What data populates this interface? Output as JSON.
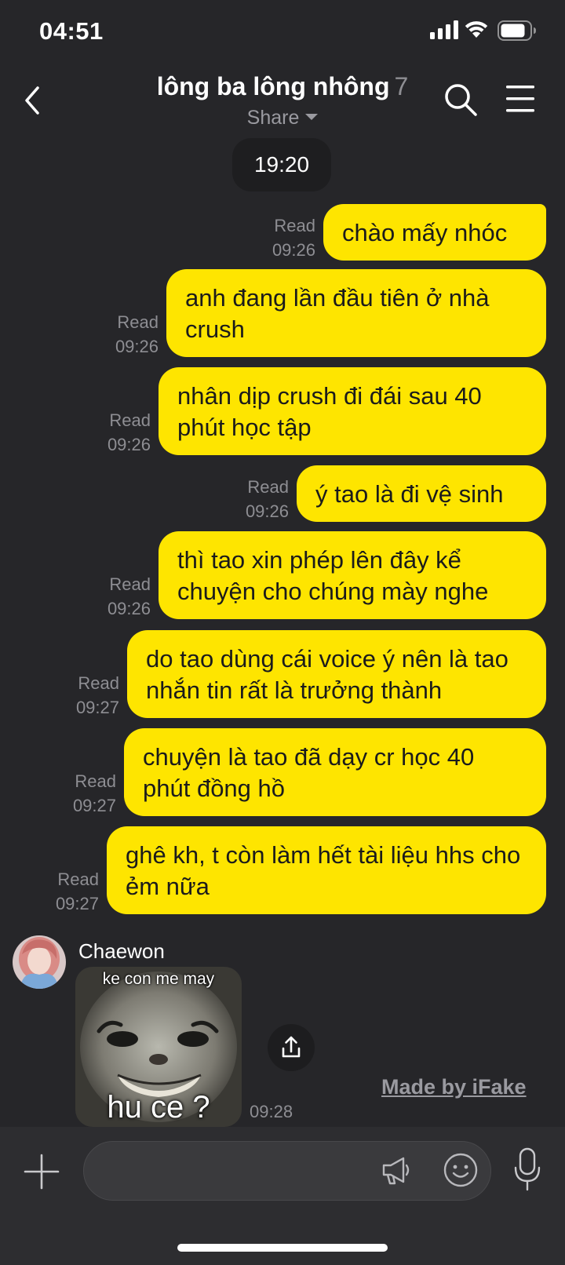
{
  "status_bar": {
    "time": "04:51"
  },
  "header": {
    "title": "lông ba lông nhông",
    "member_count": "7",
    "subtitle": "Share",
    "icons": {
      "back": "chevron-left-icon",
      "search": "search-icon",
      "menu": "menu-icon"
    }
  },
  "date_chip": "19:20",
  "messages": [
    {
      "text": "chào mấy nhóc",
      "status": "Read",
      "time": "09:26"
    },
    {
      "text": "anh đang lần đầu tiên ở nhà crush",
      "status": "Read",
      "time": "09:26"
    },
    {
      "text": "nhân dịp crush đi đái sau 40 phút học tập",
      "status": "Read",
      "time": "09:26"
    },
    {
      "text": "ý tao là đi vệ sinh",
      "status": "Read",
      "time": "09:26"
    },
    {
      "text": "thì tao xin phép lên đây kể chuyện cho chúng mày nghe",
      "status": "Read",
      "time": "09:26"
    },
    {
      "text": "do tao dùng cái voice ý nên là tao nhắn tin rất là trưởng thành",
      "status": "Read",
      "time": "09:27"
    },
    {
      "text": "chuyện là tao đã dạy cr học 40 phút đồng hồ",
      "status": "Read",
      "time": "09:27"
    },
    {
      "text": "ghê kh, t còn làm hết tài liệu hhs cho ẻm nữa",
      "status": "Read",
      "time": "09:27"
    }
  ],
  "incoming": {
    "sender": "Chaewon",
    "sticker_top_text": "ke con me may",
    "sticker_bottom_text": "hu ce ?",
    "time": "09:28"
  },
  "watermark": "Made by iFake",
  "input_bar": {
    "placeholder": "",
    "icons": {
      "add": "plus-icon",
      "broadcast": "megaphone-icon",
      "emoji": "emoji-icon",
      "voice": "microphone-icon"
    }
  },
  "colors": {
    "background": "#262629",
    "bubble_out": "#fee500",
    "input_bar": "#2d2d30"
  }
}
